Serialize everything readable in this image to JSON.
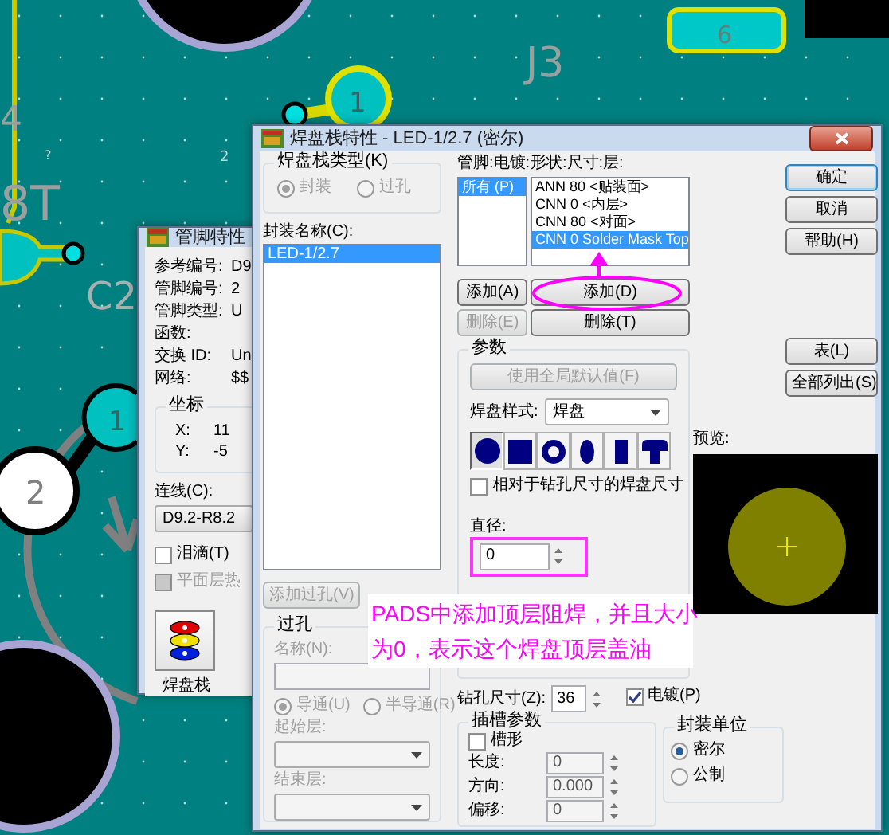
{
  "pcb_canvas": {
    "labels": [
      "J3",
      "6",
      "1",
      "4",
      "?",
      "2",
      "8T",
      "C2",
      "1",
      "2"
    ]
  },
  "pin_window": {
    "title": "管脚特性",
    "fields": [
      {
        "label": "参考编号:",
        "value": "D9"
      },
      {
        "label": "管脚编号:",
        "value": "2"
      },
      {
        "label": "管脚类型:",
        "value": "U"
      },
      {
        "label": "函数:"
      },
      {
        "label": "交换 ID:",
        "value": "Un"
      },
      {
        "label": "网络:",
        "value": "$$"
      }
    ],
    "coordinates": {
      "legend": "坐标",
      "x_label": "X:",
      "x_value": "11",
      "y_label": "Y:",
      "y_value": "-5"
    },
    "connection": {
      "label": "连线(C):",
      "value": "D9.2-R8.2"
    },
    "checkboxes": [
      {
        "label": "泪滴(T)",
        "checked": false,
        "disabled": false
      },
      {
        "label": "平面层热",
        "checked": false,
        "disabled": true
      }
    ],
    "pad_stack_button": {
      "label": "焊盘栈"
    }
  },
  "padstack_window": {
    "title": "焊盘栈特性 - LED-1/2.7 (密尔)",
    "type_group": {
      "legend": "焊盘栈类型(K)",
      "disabled": true,
      "options": [
        {
          "label": "封装",
          "selected": true
        },
        {
          "label": "过孔",
          "selected": false
        }
      ]
    },
    "decal_label": "封装名称(C):",
    "decals": [
      {
        "text": "LED-1/2.7",
        "selected": true
      }
    ],
    "add_via_button": {
      "label": "添加过孔(V)",
      "disabled": true
    },
    "via_group": {
      "legend": "过孔",
      "disabled": true,
      "name_label": "名称(N):",
      "options": [
        {
          "label": "导通(U)",
          "selected": true
        },
        {
          "label": "半导通(R)",
          "selected": false
        }
      ],
      "start_layer_label": "起始层:",
      "end_layer_label": "结束层:"
    },
    "pin_plating_label": "管脚:电镀:",
    "pins": [
      {
        "text": "所有 (P)",
        "selected": true
      }
    ],
    "shape_label": "形状:尺寸:层:",
    "layers": [
      {
        "text": "ANN 80 <贴装面>",
        "selected": false
      },
      {
        "text": "CNN 0 <内层>",
        "selected": false
      },
      {
        "text": "CNN 80 <对面>",
        "selected": false
      },
      {
        "text": "CNN 0 Solder Mask Top",
        "selected": true
      }
    ],
    "pin_buttons": [
      {
        "label": "添加(A)",
        "disabled": false
      },
      {
        "label": "删除(E)",
        "disabled": true
      }
    ],
    "layer_buttons": [
      {
        "label": "添加(D)",
        "disabled": false
      },
      {
        "label": "删除(T)",
        "disabled": false
      }
    ],
    "parameters": {
      "legend": "参数",
      "defaults_button": {
        "label": "使用全局默认值(F)",
        "disabled": true
      },
      "style_label": "焊盘样式:",
      "style_value": "焊盘",
      "shapes": [
        {
          "kind": "round",
          "selected": true
        },
        {
          "kind": "square",
          "selected": false
        },
        {
          "kind": "annular",
          "selected": false
        },
        {
          "kind": "oval",
          "selected": false
        },
        {
          "kind": "rectangle",
          "selected": false
        },
        {
          "kind": "custom",
          "selected": false
        }
      ],
      "relative_checkbox": {
        "label": "相对于钻孔尺寸的焊盘尺寸",
        "checked": false
      },
      "diameter_label": "直径:",
      "diameter_value": "0"
    },
    "dialog_buttons": [
      {
        "label": "确定",
        "default": true
      },
      {
        "label": "取消",
        "default": false
      },
      {
        "label": "帮助(H)",
        "default": false
      }
    ],
    "list_buttons": [
      {
        "label": "表(L)"
      },
      {
        "label": "全部列出(S)"
      }
    ],
    "preview_label": "预览:",
    "drill": {
      "label": "钻孔尺寸(Z):",
      "value": "36",
      "plated": {
        "label": "电镀(P)",
        "checked": true
      }
    },
    "slot_group": {
      "legend": "插槽参数",
      "slotted": {
        "label": "槽形",
        "checked": false
      },
      "fields": [
        {
          "label": "长度:",
          "value": "0"
        },
        {
          "label": "方向:",
          "value": "0.000"
        },
        {
          "label": "偏移:",
          "value": "0"
        }
      ]
    },
    "units_group": {
      "legend": "封装单位",
      "options": [
        {
          "label": "密尔",
          "selected": true
        },
        {
          "label": "公制",
          "selected": false
        }
      ]
    }
  },
  "annotation": {
    "lines": [
      "PADS中添加顶层阻焊，并且大小",
      "为0，表示这个焊盘顶层盖油"
    ]
  }
}
